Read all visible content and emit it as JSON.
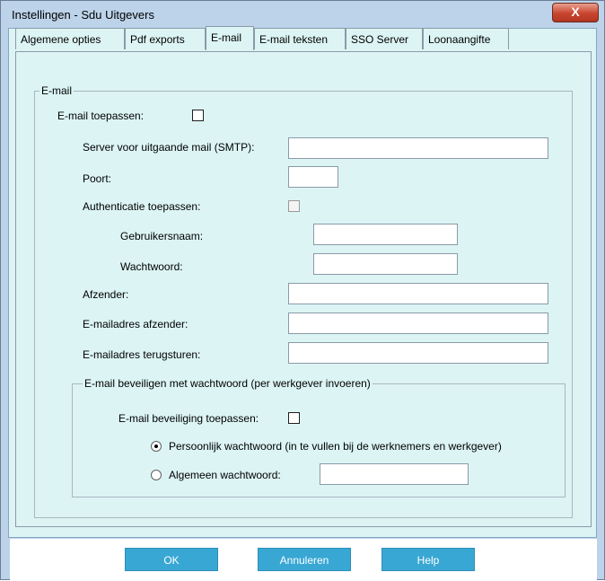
{
  "window": {
    "title": "Instellingen - Sdu Uitgevers",
    "close_label": "X"
  },
  "tabs": [
    {
      "label": "Algemene opties"
    },
    {
      "label": "Pdf exports"
    },
    {
      "label": "E-mail"
    },
    {
      "label": "E-mail teksten"
    },
    {
      "label": "SSO Server"
    },
    {
      "label": "Loonaangifte"
    }
  ],
  "email_group": {
    "legend": "E-mail",
    "apply_label": "E-mail toepassen:",
    "apply_checked": false,
    "smtp_label": "Server voor uitgaande mail (SMTP):",
    "smtp_value": "",
    "port_label": "Poort:",
    "port_value": "",
    "auth_label": "Authenticatie toepassen:",
    "auth_checked": false,
    "username_label": "Gebruikersnaam:",
    "username_value": "",
    "password_label": "Wachtwoord:",
    "password_value": "",
    "sender_label": "Afzender:",
    "sender_value": "",
    "sender_address_label": "E-mailadres afzender:",
    "sender_address_value": "",
    "return_address_label": "E-mailadres terugsturen:",
    "return_address_value": ""
  },
  "security_group": {
    "legend": "E-mail beveiligen met wachtwoord (per werkgever invoeren)",
    "apply_label": "E-mail beveiliging toepassen:",
    "apply_checked": false,
    "personal_label": "Persoonlijk wachtwoord (in te vullen bij de werknemers en werkgever)",
    "personal_selected": true,
    "general_label": "Algemeen wachtwoord:",
    "general_value": ""
  },
  "buttons": {
    "ok": "OK",
    "cancel": "Annuleren",
    "help": "Help"
  }
}
